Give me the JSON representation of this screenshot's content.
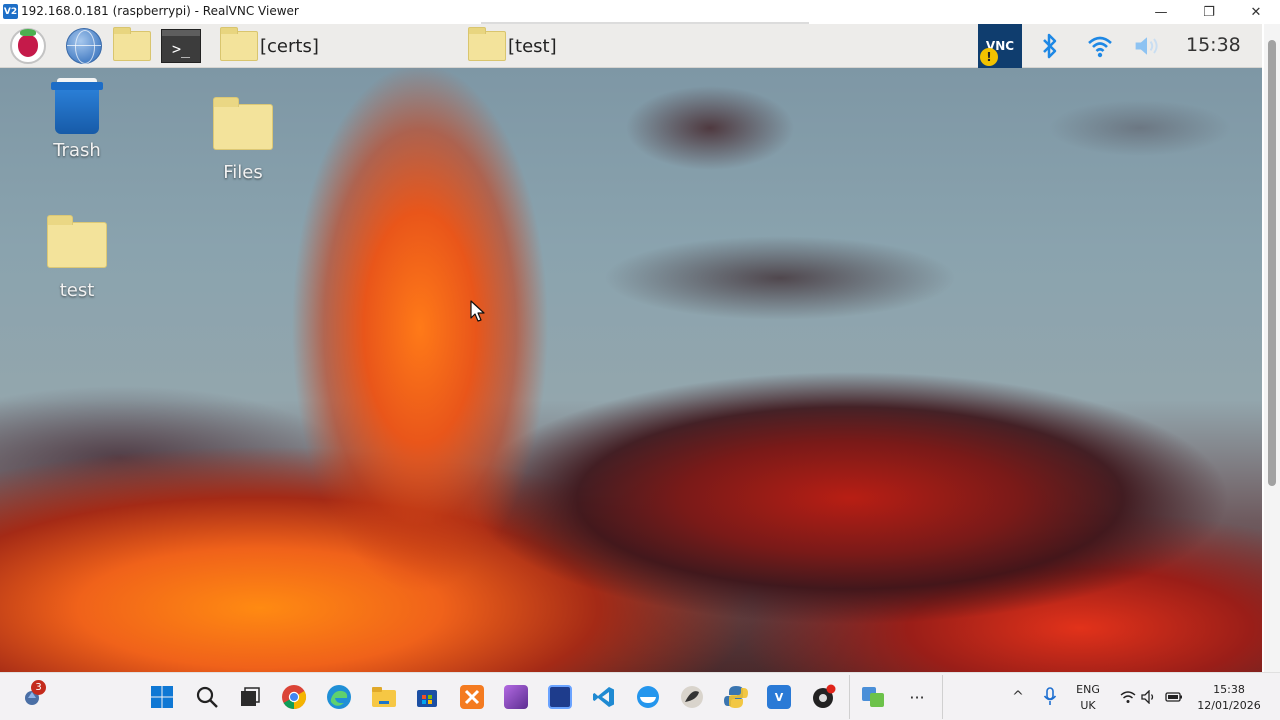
{
  "viewer": {
    "title": "192.168.0.181 (raspberrypi) - RealVNC Viewer",
    "app_icon_text": "V2",
    "minimize_glyph": "—",
    "restore_glyph": "❐",
    "close_glyph": "✕"
  },
  "pi_panel": {
    "terminal_glyph": ">_",
    "tasks": [
      {
        "label": "[certs]"
      },
      {
        "label": "[test]"
      }
    ],
    "vnc_tray_text": "VNC",
    "vnc_warning_glyph": "!",
    "clock": "15:38",
    "accent": "#1e88e5"
  },
  "desktop": {
    "icons": [
      {
        "label": "Trash"
      },
      {
        "label": "Files"
      },
      {
        "label": "test"
      }
    ]
  },
  "taskbar": {
    "notification_count": "3",
    "apps": [
      "start-icon",
      "search-icon",
      "task-view-icon",
      "chrome-icon",
      "edge-icon",
      "file-explorer-icon",
      "store-icon",
      "xampp-icon",
      "visual-studio-icon",
      "remote-desktop-icon",
      "vscode-icon",
      "docker-icon",
      "inkscape-icon",
      "python-icon",
      "realvnc-icon",
      "obs-icon",
      "translate-icon",
      "more-icon"
    ],
    "more_glyph": "···",
    "chevron_glyph": "^",
    "lang_line1": "ENG",
    "lang_line2": "UK",
    "time": "15:38",
    "date": "12/01/2026"
  }
}
